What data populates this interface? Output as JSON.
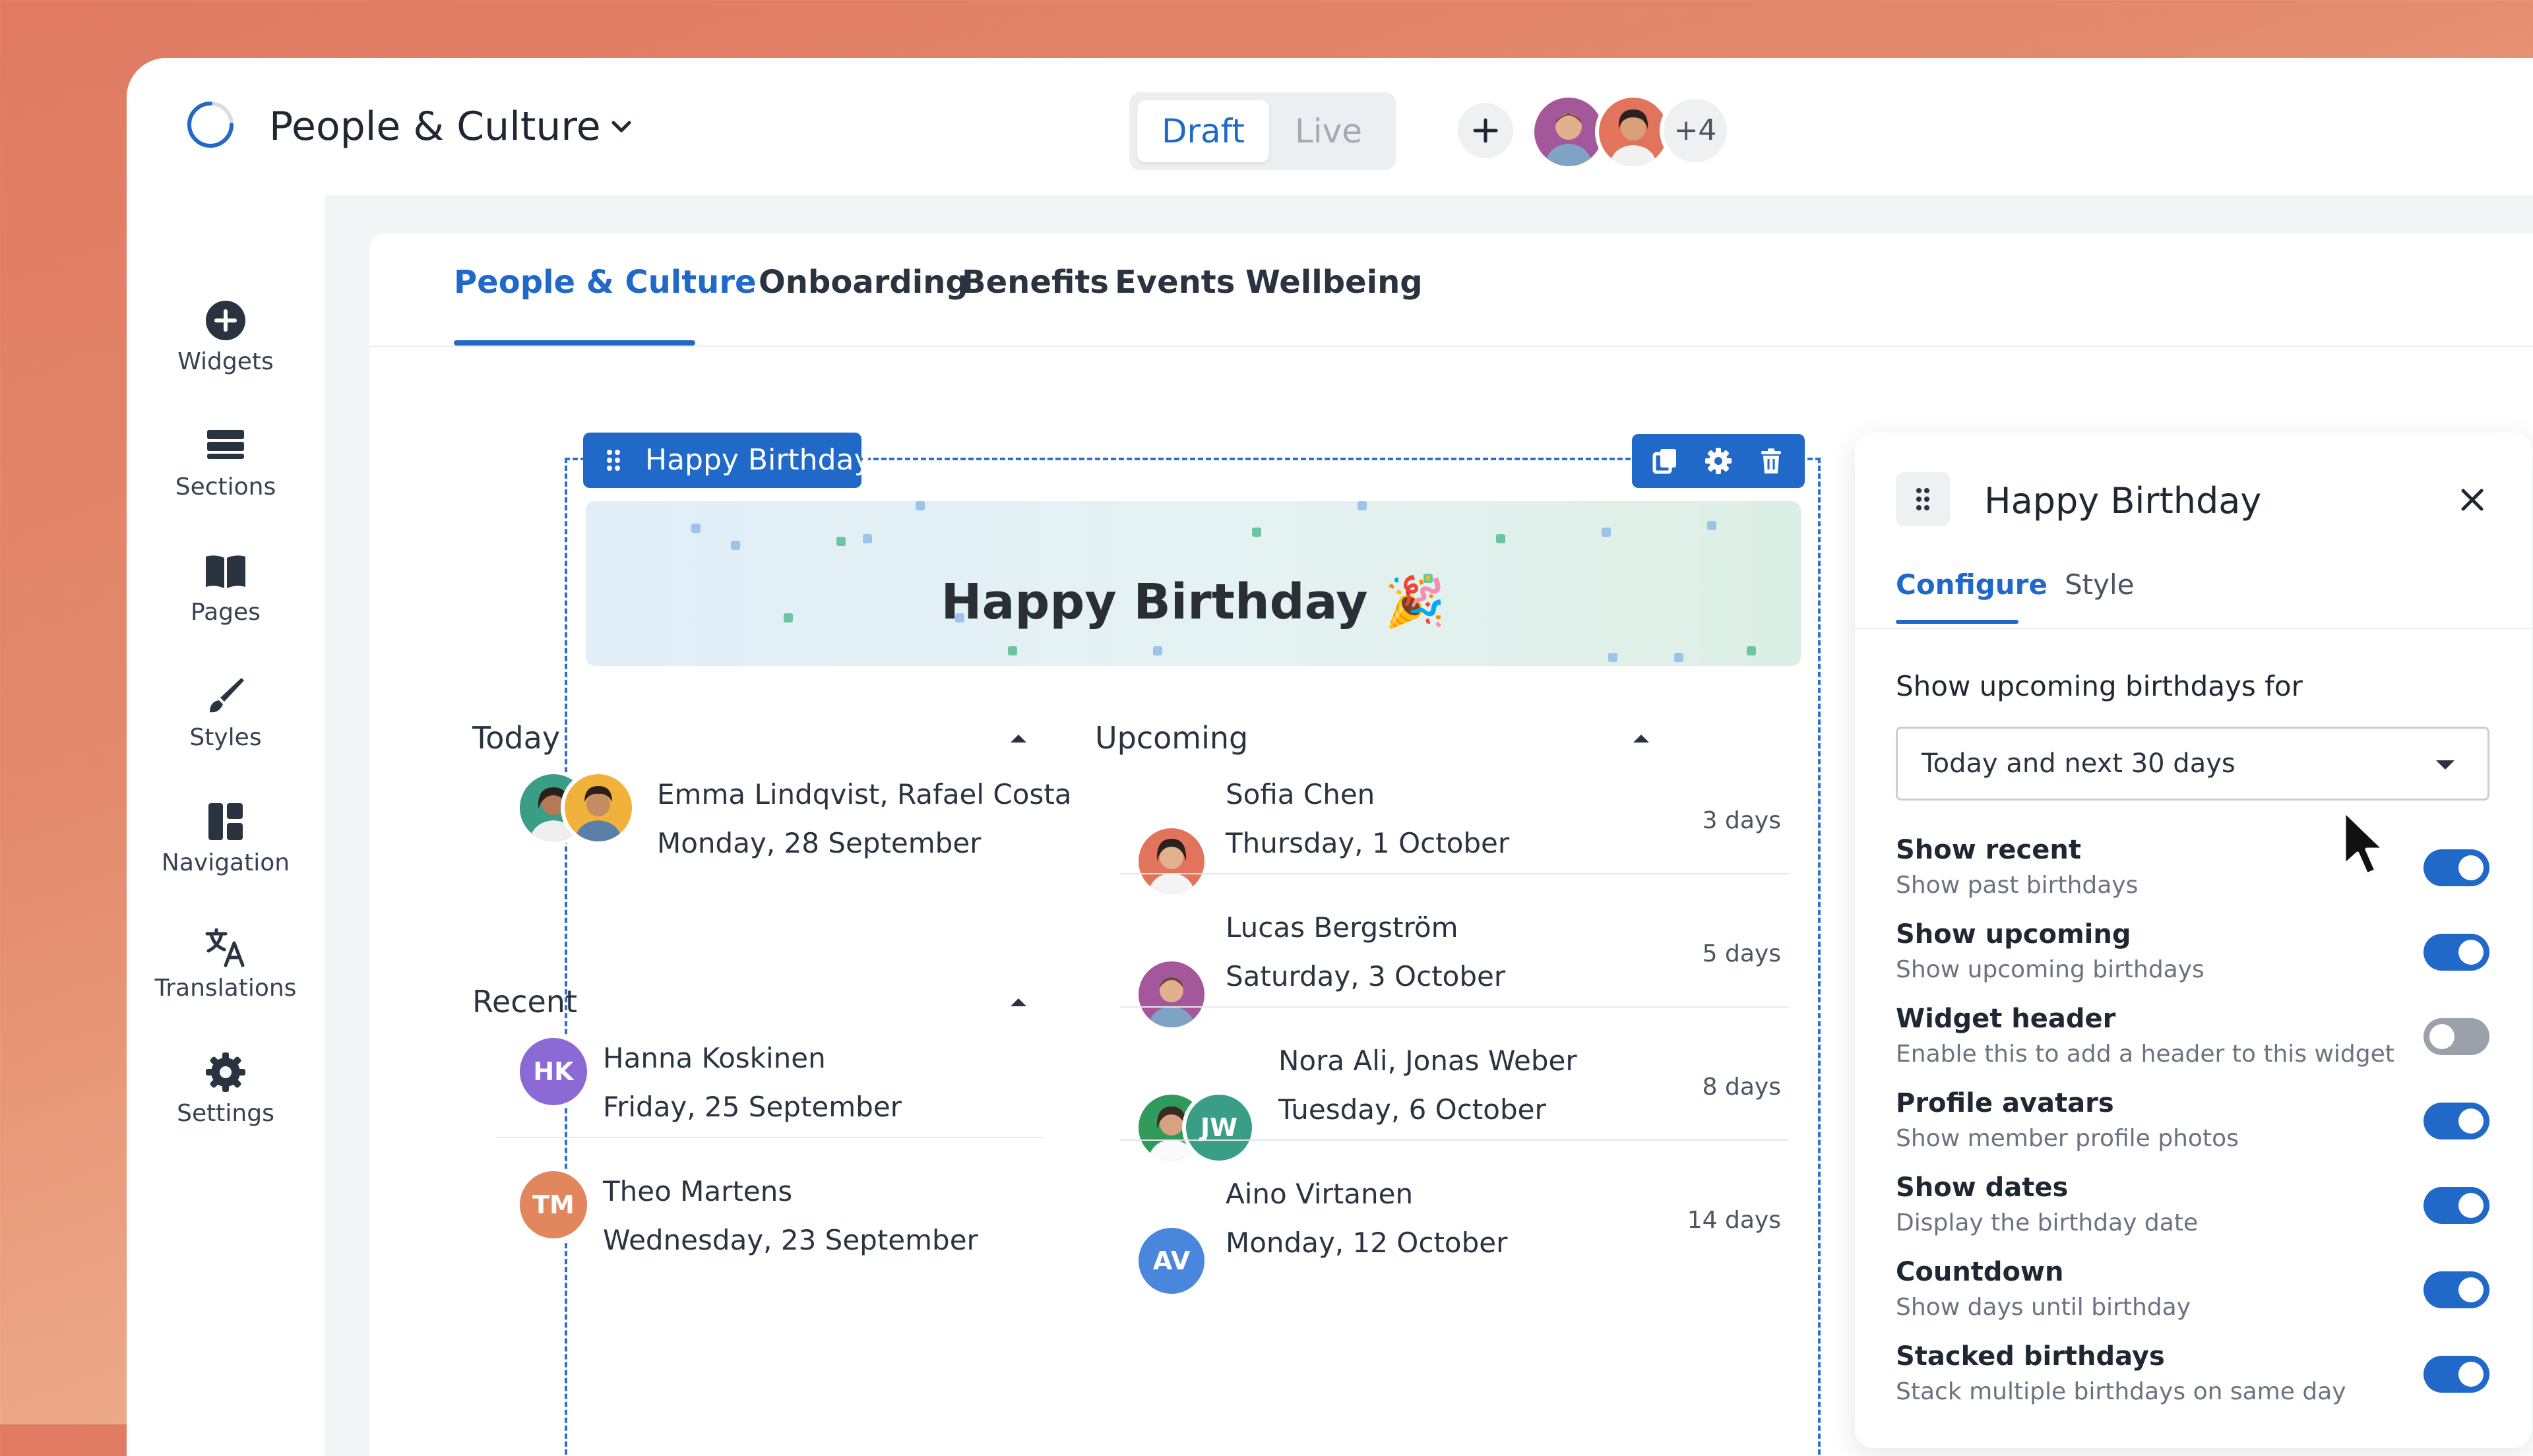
{
  "app": {
    "title": "People & Culture"
  },
  "mode_toggle": {
    "draft": "Draft",
    "live": "Live"
  },
  "collaborators": {
    "more": "+4"
  },
  "sidebar": {
    "items": [
      {
        "label": "Widgets",
        "icon": "plus-circle-icon"
      },
      {
        "label": "Sections",
        "icon": "sections-icon"
      },
      {
        "label": "Pages",
        "icon": "book-icon"
      },
      {
        "label": "Styles",
        "icon": "brush-icon"
      },
      {
        "label": "Navigation",
        "icon": "navigation-icon"
      },
      {
        "label": "Translations",
        "icon": "translate-icon"
      },
      {
        "label": "Settings",
        "icon": "gear-icon"
      }
    ]
  },
  "tabs": [
    "People & Culture",
    "Onboarding",
    "Benefits",
    "Events",
    "Wellbeing"
  ],
  "widget": {
    "tag": "Happy Birthday",
    "banner_title": "Happy Birthday 🎉",
    "today": {
      "title": "Today",
      "rows": [
        {
          "name": "Emma Lindqvist, Rafael Costa",
          "date": "Monday, 28 September"
        }
      ]
    },
    "recent": {
      "title": "Recent",
      "rows": [
        {
          "initials": "HK",
          "name": "Hanna Koskinen",
          "date": "Friday, 25 September",
          "color": "#8b6ad6"
        },
        {
          "initials": "TM",
          "name": "Theo Martens",
          "date": "Wednesday, 23 September",
          "color": "#e2865e"
        }
      ]
    },
    "upcoming": {
      "title": "Upcoming",
      "rows": [
        {
          "name": "Sofia Chen",
          "date": "Thursday, 1 October",
          "days": "3 days"
        },
        {
          "name": "Lucas Bergström",
          "date": "Saturday, 3 October",
          "days": "5 days"
        },
        {
          "name": "Nora Ali, Jonas Weber",
          "date": "Tuesday, 6 October",
          "days": "8 days",
          "initials": "JW",
          "color": "#3a9d86"
        },
        {
          "name": "Aino Virtanen",
          "date": "Monday, 12 October",
          "days": "14 days",
          "initials": "AV",
          "color": "#4a86dc"
        }
      ]
    }
  },
  "panel": {
    "title": "Happy Birthday",
    "tabs": {
      "configure": "Configure",
      "style": "Style"
    },
    "show_label": "Show upcoming birthdays for",
    "select_value": "Today and next 30 days",
    "options": [
      {
        "title": "Show recent",
        "desc": "Show past birthdays",
        "on": true
      },
      {
        "title": "Show upcoming",
        "desc": "Show upcoming birthdays",
        "on": true
      },
      {
        "title": "Widget header",
        "desc": "Enable this to add a header to this widget",
        "on": false
      },
      {
        "title": "Profile avatars",
        "desc": "Show member profile photos",
        "on": true
      },
      {
        "title": "Show dates",
        "desc": "Display the birthday date",
        "on": true
      },
      {
        "title": "Countdown",
        "desc": "Show days until birthday",
        "on": true
      },
      {
        "title": "Stacked birthdays",
        "desc": "Stack multiple birthdays on same day",
        "on": true
      }
    ]
  },
  "colors": {
    "accent": "#2069c9",
    "toggle_off": "#9aa1aa"
  }
}
